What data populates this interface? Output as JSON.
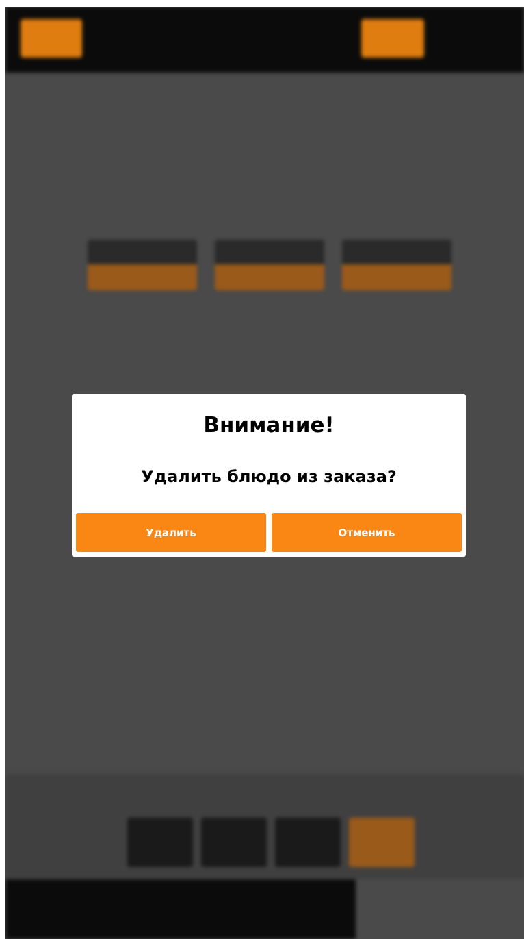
{
  "dialog": {
    "title": "Внимание!",
    "message": "Удалить блюдо из заказа?",
    "delete_label": "Удалить",
    "cancel_label": "Отменить"
  },
  "colors": {
    "accent": "#fa8613",
    "overlay": "#4a4a4a",
    "dark": "#0b0b0b",
    "dialog_bg": "#ffffff"
  }
}
